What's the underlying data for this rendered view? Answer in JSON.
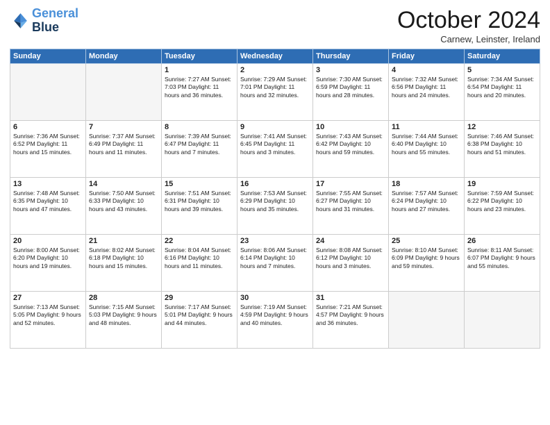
{
  "header": {
    "logo_line1": "General",
    "logo_line2": "Blue",
    "title": "October 2024",
    "subtitle": "Carnew, Leinster, Ireland"
  },
  "weekdays": [
    "Sunday",
    "Monday",
    "Tuesday",
    "Wednesday",
    "Thursday",
    "Friday",
    "Saturday"
  ],
  "weeks": [
    [
      {
        "day": "",
        "info": ""
      },
      {
        "day": "",
        "info": ""
      },
      {
        "day": "1",
        "info": "Sunrise: 7:27 AM\nSunset: 7:03 PM\nDaylight: 11 hours\nand 36 minutes."
      },
      {
        "day": "2",
        "info": "Sunrise: 7:29 AM\nSunset: 7:01 PM\nDaylight: 11 hours\nand 32 minutes."
      },
      {
        "day": "3",
        "info": "Sunrise: 7:30 AM\nSunset: 6:59 PM\nDaylight: 11 hours\nand 28 minutes."
      },
      {
        "day": "4",
        "info": "Sunrise: 7:32 AM\nSunset: 6:56 PM\nDaylight: 11 hours\nand 24 minutes."
      },
      {
        "day": "5",
        "info": "Sunrise: 7:34 AM\nSunset: 6:54 PM\nDaylight: 11 hours\nand 20 minutes."
      }
    ],
    [
      {
        "day": "6",
        "info": "Sunrise: 7:36 AM\nSunset: 6:52 PM\nDaylight: 11 hours\nand 15 minutes."
      },
      {
        "day": "7",
        "info": "Sunrise: 7:37 AM\nSunset: 6:49 PM\nDaylight: 11 hours\nand 11 minutes."
      },
      {
        "day": "8",
        "info": "Sunrise: 7:39 AM\nSunset: 6:47 PM\nDaylight: 11 hours\nand 7 minutes."
      },
      {
        "day": "9",
        "info": "Sunrise: 7:41 AM\nSunset: 6:45 PM\nDaylight: 11 hours\nand 3 minutes."
      },
      {
        "day": "10",
        "info": "Sunrise: 7:43 AM\nSunset: 6:42 PM\nDaylight: 10 hours\nand 59 minutes."
      },
      {
        "day": "11",
        "info": "Sunrise: 7:44 AM\nSunset: 6:40 PM\nDaylight: 10 hours\nand 55 minutes."
      },
      {
        "day": "12",
        "info": "Sunrise: 7:46 AM\nSunset: 6:38 PM\nDaylight: 10 hours\nand 51 minutes."
      }
    ],
    [
      {
        "day": "13",
        "info": "Sunrise: 7:48 AM\nSunset: 6:35 PM\nDaylight: 10 hours\nand 47 minutes."
      },
      {
        "day": "14",
        "info": "Sunrise: 7:50 AM\nSunset: 6:33 PM\nDaylight: 10 hours\nand 43 minutes."
      },
      {
        "day": "15",
        "info": "Sunrise: 7:51 AM\nSunset: 6:31 PM\nDaylight: 10 hours\nand 39 minutes."
      },
      {
        "day": "16",
        "info": "Sunrise: 7:53 AM\nSunset: 6:29 PM\nDaylight: 10 hours\nand 35 minutes."
      },
      {
        "day": "17",
        "info": "Sunrise: 7:55 AM\nSunset: 6:27 PM\nDaylight: 10 hours\nand 31 minutes."
      },
      {
        "day": "18",
        "info": "Sunrise: 7:57 AM\nSunset: 6:24 PM\nDaylight: 10 hours\nand 27 minutes."
      },
      {
        "day": "19",
        "info": "Sunrise: 7:59 AM\nSunset: 6:22 PM\nDaylight: 10 hours\nand 23 minutes."
      }
    ],
    [
      {
        "day": "20",
        "info": "Sunrise: 8:00 AM\nSunset: 6:20 PM\nDaylight: 10 hours\nand 19 minutes."
      },
      {
        "day": "21",
        "info": "Sunrise: 8:02 AM\nSunset: 6:18 PM\nDaylight: 10 hours\nand 15 minutes."
      },
      {
        "day": "22",
        "info": "Sunrise: 8:04 AM\nSunset: 6:16 PM\nDaylight: 10 hours\nand 11 minutes."
      },
      {
        "day": "23",
        "info": "Sunrise: 8:06 AM\nSunset: 6:14 PM\nDaylight: 10 hours\nand 7 minutes."
      },
      {
        "day": "24",
        "info": "Sunrise: 8:08 AM\nSunset: 6:12 PM\nDaylight: 10 hours\nand 3 minutes."
      },
      {
        "day": "25",
        "info": "Sunrise: 8:10 AM\nSunset: 6:09 PM\nDaylight: 9 hours\nand 59 minutes."
      },
      {
        "day": "26",
        "info": "Sunrise: 8:11 AM\nSunset: 6:07 PM\nDaylight: 9 hours\nand 55 minutes."
      }
    ],
    [
      {
        "day": "27",
        "info": "Sunrise: 7:13 AM\nSunset: 5:05 PM\nDaylight: 9 hours\nand 52 minutes."
      },
      {
        "day": "28",
        "info": "Sunrise: 7:15 AM\nSunset: 5:03 PM\nDaylight: 9 hours\nand 48 minutes."
      },
      {
        "day": "29",
        "info": "Sunrise: 7:17 AM\nSunset: 5:01 PM\nDaylight: 9 hours\nand 44 minutes."
      },
      {
        "day": "30",
        "info": "Sunrise: 7:19 AM\nSunset: 4:59 PM\nDaylight: 9 hours\nand 40 minutes."
      },
      {
        "day": "31",
        "info": "Sunrise: 7:21 AM\nSunset: 4:57 PM\nDaylight: 9 hours\nand 36 minutes."
      },
      {
        "day": "",
        "info": ""
      },
      {
        "day": "",
        "info": ""
      }
    ]
  ]
}
